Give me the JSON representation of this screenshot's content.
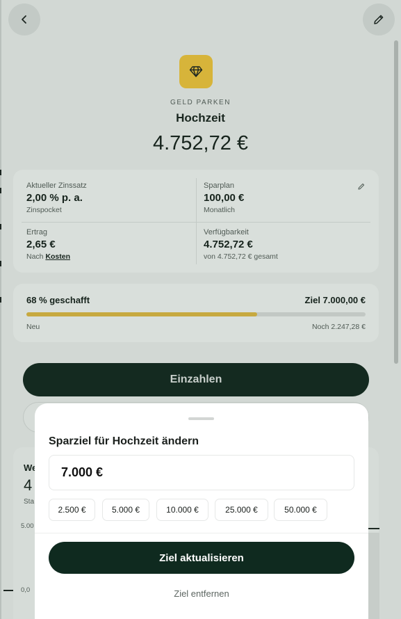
{
  "header": {
    "back_icon": "chevron-left-icon",
    "edit_icon": "pencil-icon"
  },
  "hero": {
    "icon": "diamond-icon",
    "category": "GELD PARKEN",
    "title": "Hochzeit",
    "balance": "4.752,72 €"
  },
  "info": {
    "rate_label": "Aktueller Zinssatz",
    "rate_value": "2,00 % p. a.",
    "rate_sub": "Zinspocket",
    "plan_label": "Sparplan",
    "plan_value": "100,00 €",
    "plan_sub": "Monatlich",
    "yield_label": "Ertrag",
    "yield_value": "2,65 €",
    "yield_sub_prefix": "Nach",
    "yield_sub_link": "Kosten",
    "avail_label": "Verfügbarkeit",
    "avail_value": "4.752,72 €",
    "avail_sub": "von 4.752,72 € gesamt"
  },
  "progress": {
    "done_label": "68 % geschafft",
    "goal_label": "Ziel 7.000,00 €",
    "fraction": 0.68,
    "start_label": "Neu",
    "remaining_label": "Noch 2.247,28 €",
    "bar_color": "#c7a940"
  },
  "actions": {
    "deposit_label": "Einzahlen"
  },
  "behind_card": {
    "title": "We",
    "value": "4",
    "sub": "Sta",
    "axis_top": "5.00",
    "axis_bottom": "0,0"
  },
  "sheet": {
    "title": "Sparziel für Hochzeit ändern",
    "amount": "7.000 €",
    "chips": [
      "2.500 €",
      "5.000 €",
      "10.000 €",
      "25.000 €",
      "50.000 €"
    ],
    "update_label": "Ziel aktualisieren",
    "remove_label": "Ziel entfernen"
  },
  "colors": {
    "accent_dark": "#0f2a1f",
    "gold": "#d7b43a"
  }
}
